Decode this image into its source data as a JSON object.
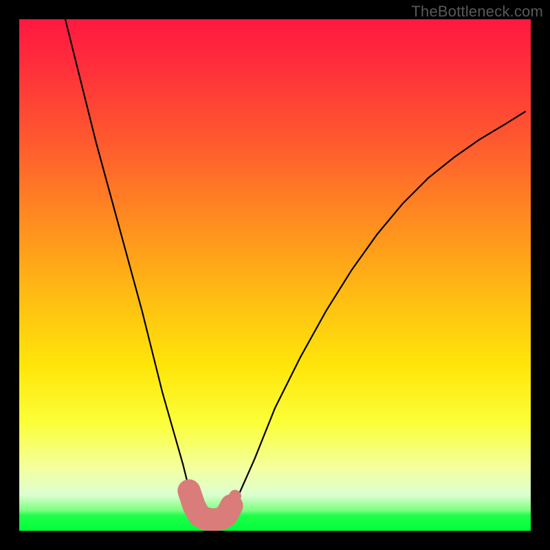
{
  "watermark": "TheBottleneck.com",
  "chart_data": {
    "type": "line",
    "title": "",
    "xlabel": "",
    "ylabel": "",
    "xlim": [
      0,
      100
    ],
    "ylim": [
      0,
      100
    ],
    "grid": false,
    "legend": false,
    "series": [
      {
        "name": "bottleneck-curve",
        "color": "#000000",
        "x": [
          9,
          12,
          15,
          18,
          21,
          24,
          26,
          28,
          30,
          32,
          33,
          34,
          35,
          36.5,
          38,
          39.5,
          41,
          42,
          46,
          50,
          55,
          60,
          65,
          70,
          75,
          80,
          85,
          90,
          95,
          99
        ],
        "y": [
          100,
          88,
          76,
          65,
          54,
          43,
          35,
          27,
          20,
          13,
          9,
          6,
          3.5,
          2.2,
          2,
          2.2,
          3.5,
          5,
          14,
          24,
          34,
          43,
          51,
          58,
          64,
          69,
          73,
          76.5,
          79.5,
          82
        ]
      }
    ],
    "markers": [
      {
        "name": "valley-highlight",
        "type": "segment",
        "color": "#d97c7a",
        "width": 4.5,
        "points": [
          {
            "x": 33.2,
            "y": 7.8
          },
          {
            "x": 34.2,
            "y": 4.8
          },
          {
            "x": 35.2,
            "y": 3.0
          },
          {
            "x": 36.5,
            "y": 2.3
          },
          {
            "x": 38.0,
            "y": 2.1
          },
          {
            "x": 39.3,
            "y": 2.3
          },
          {
            "x": 40.5,
            "y": 3.0
          },
          {
            "x": 41.5,
            "y": 4.9
          }
        ]
      },
      {
        "name": "marker-dot",
        "type": "dot",
        "color": "#d97c7a",
        "r": 1.2,
        "x": 42.2,
        "y": 6.8
      }
    ],
    "gradient_stops": [
      {
        "pct": 0,
        "color": "#ff193f"
      },
      {
        "pct": 25,
        "color": "#ff5d2e"
      },
      {
        "pct": 55,
        "color": "#ffbf12"
      },
      {
        "pct": 79,
        "color": "#fbff39"
      },
      {
        "pct": 93,
        "color": "#dcffd0"
      },
      {
        "pct": 100,
        "color": "#00ff3a"
      }
    ]
  }
}
